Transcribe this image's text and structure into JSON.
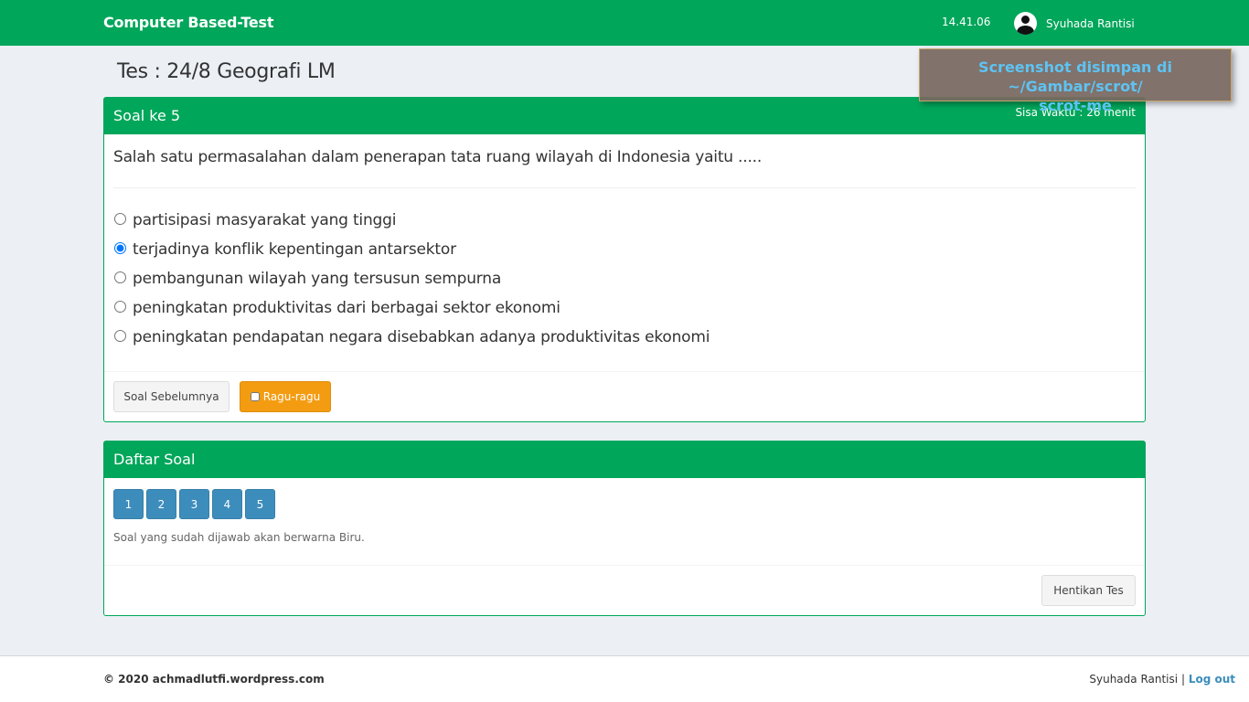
{
  "header": {
    "brand": "Computer Based-Test",
    "clock": "14.41.06",
    "user_name": "Syuhada Rantisi",
    "user_icon": "user-avatar-icon"
  },
  "page": {
    "title": "Tes : 24/8 Geografi LM"
  },
  "notification": {
    "line1": "Screenshot disimpan di ~/Gambar/scrot/",
    "line2": "scrot-me"
  },
  "question_box": {
    "title": "Soal ke 5",
    "timer": "Sisa Waktu : 26 menit",
    "question": "Salah satu permasalahan dalam penerapan tata ruang wilayah di Indonesia yaitu .....",
    "selected_index": 1,
    "options": [
      "partisipasi masyarakat yang tinggi",
      "terjadinya konflik kepentingan antarsektor",
      "pembangunan wilayah yang tersusun sempurna",
      "peningkatan produktivitas dari berbagai sektor ekonomi",
      "peningkatan pendapatan negara disebabkan adanya produktivitas ekonomi"
    ],
    "prev_button": "Soal Sebelumnya",
    "doubt_button": "Ragu-ragu"
  },
  "question_list": {
    "title": "Daftar Soal",
    "numbers": [
      "1",
      "2",
      "3",
      "4",
      "5"
    ],
    "answered_color": "#3c8dbc",
    "hint": "Soal yang sudah dijawab akan berwarna Biru.",
    "stop_button": "Hentikan Tes"
  },
  "footer": {
    "copyright": "© 2020 achmadlutfi.wordpress.com",
    "user_name": "Syuhada Rantisi",
    "separator": "|",
    "logout": "Log out"
  },
  "colors": {
    "primary_green": "#00a65a",
    "answered_blue": "#3c8dbc",
    "warning_orange": "#f39c12"
  }
}
